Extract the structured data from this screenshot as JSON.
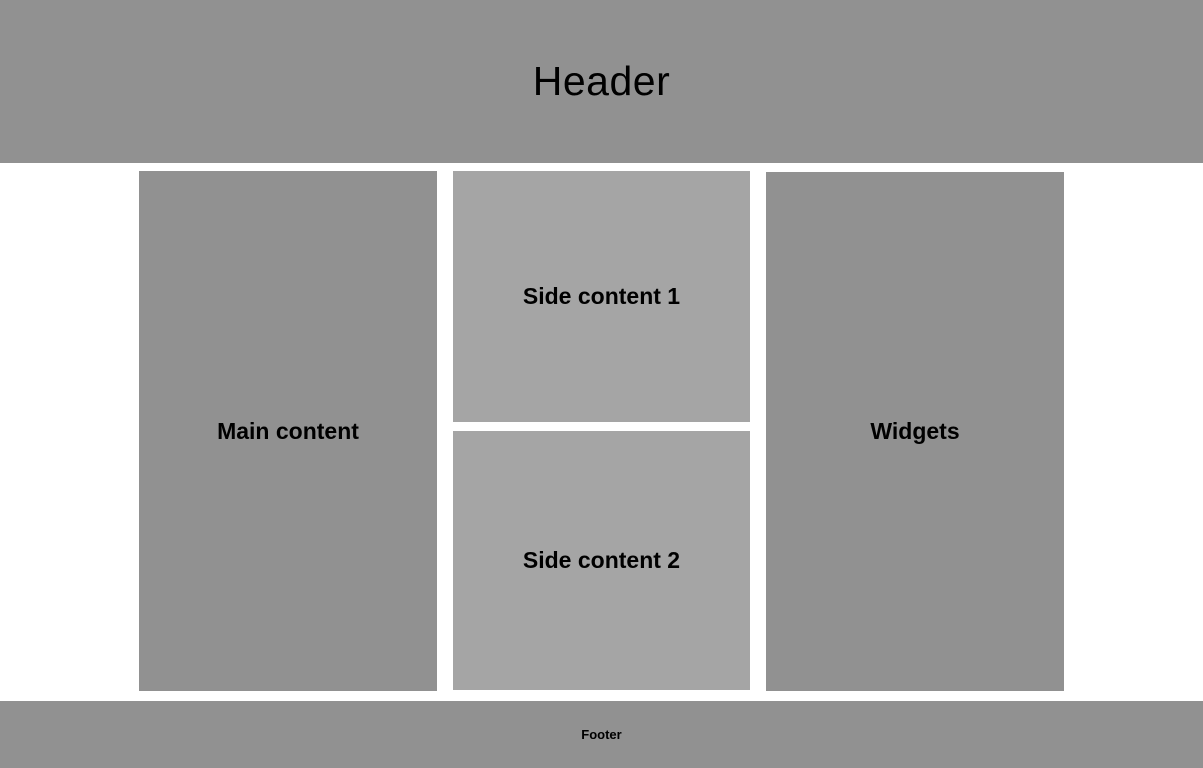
{
  "header": {
    "label": "Header"
  },
  "main": {
    "label": "Main content"
  },
  "side_content_1": {
    "label": "Side content 1"
  },
  "side_content_2": {
    "label": "Side content 2"
  },
  "widgets": {
    "label": "Widgets"
  },
  "footer": {
    "label": "Footer"
  },
  "colors": {
    "dark_block": "#919191",
    "light_block": "#a5a5a5",
    "background": "#ffffff",
    "text": "#000000"
  }
}
